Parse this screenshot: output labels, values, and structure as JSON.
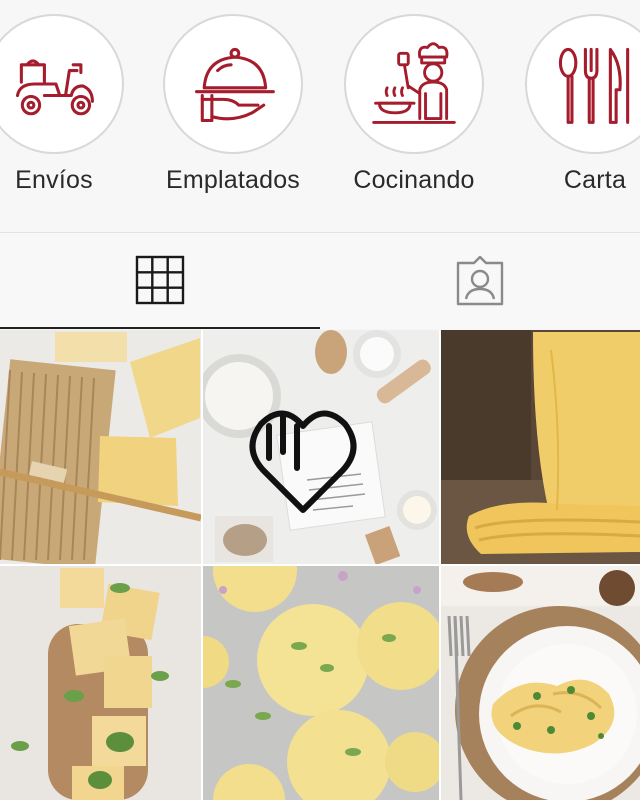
{
  "highlights": [
    {
      "label": "Envíos",
      "icon": "scooter-icon"
    },
    {
      "label": "Emplatados",
      "icon": "serving-cloche-icon"
    },
    {
      "label": "Cocinando",
      "icon": "chef-cooking-icon"
    },
    {
      "label": "Carta",
      "icon": "cutlery-icon"
    }
  ],
  "tabs": [
    {
      "name": "grid-icon",
      "active": true
    },
    {
      "name": "tagged-person-icon",
      "active": false
    }
  ],
  "posts": [
    {
      "name": "fresh-pasta-sheets"
    },
    {
      "name": "flour-and-recipe-with-heart-logo"
    },
    {
      "name": "folded-pasta-sheets"
    },
    {
      "name": "ravioli-on-board"
    },
    {
      "name": "round-ravioli"
    },
    {
      "name": "ravioli-plate"
    }
  ],
  "colors": {
    "accent": "#a51c2c",
    "ring": "#d8d8d8",
    "text": "#2a2a2a"
  }
}
